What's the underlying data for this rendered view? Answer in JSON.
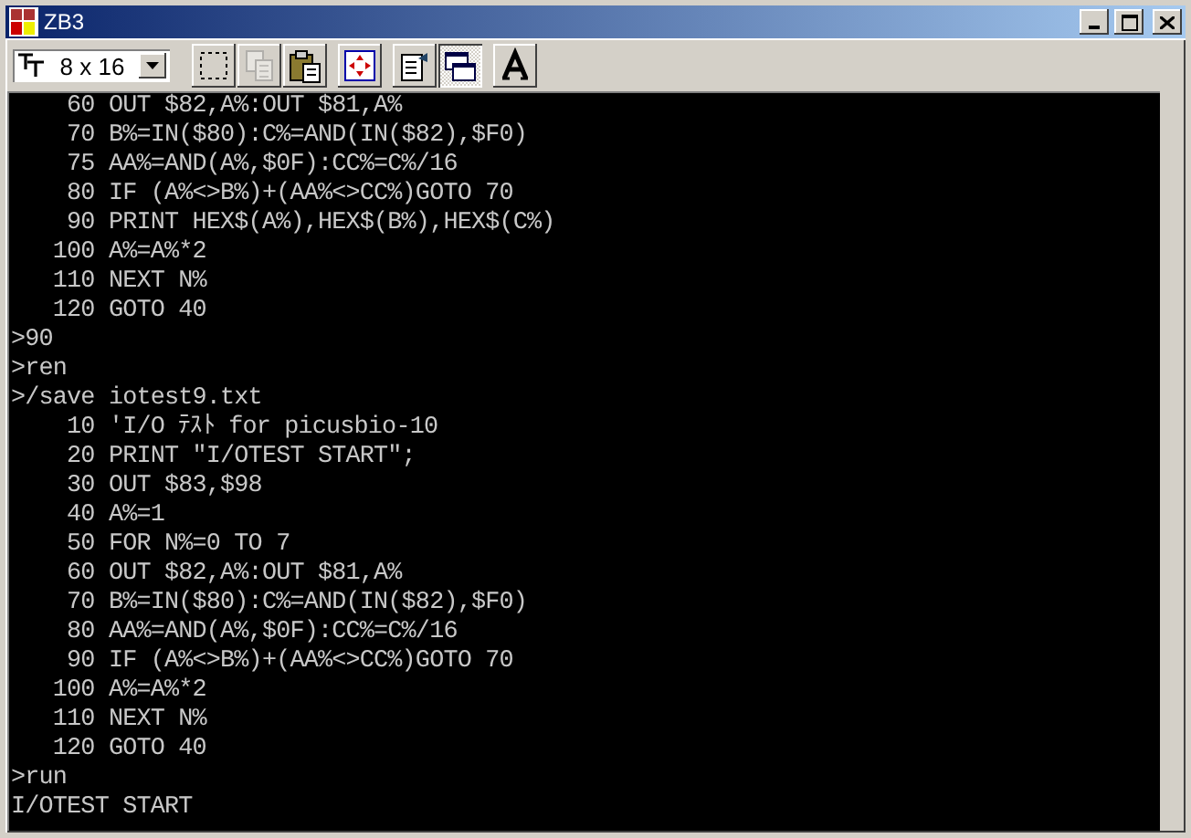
{
  "window": {
    "title": "ZB3"
  },
  "toolbar": {
    "font_selector": {
      "value": "8 x 16"
    },
    "buttons": [
      {
        "kind": "select",
        "disabled": false,
        "pressed": false
      },
      {
        "kind": "copy",
        "disabled": true,
        "pressed": false
      },
      {
        "kind": "paste",
        "disabled": false,
        "pressed": false
      },
      {
        "kind": "move",
        "disabled": false,
        "pressed": false
      },
      {
        "kind": "properties",
        "disabled": false,
        "pressed": false
      },
      {
        "kind": "window",
        "disabled": false,
        "pressed": true
      },
      {
        "kind": "font",
        "disabled": false,
        "pressed": false
      }
    ]
  },
  "terminal": {
    "lines": [
      "    60 OUT $82,A%:OUT $81,A%",
      "    70 B%=IN($80):C%=AND(IN($82),$F0)",
      "    75 AA%=AND(A%,$0F):CC%=C%/16",
      "    80 IF (A%<>B%)+(AA%<>CC%)GOTO 70",
      "    90 PRINT HEX$(A%),HEX$(B%),HEX$(C%)",
      "   100 A%=A%*2",
      "   110 NEXT N%",
      "   120 GOTO 40",
      ">90",
      ">ren",
      ">/save iotest9.txt",
      "    10 'I/O ﾃｽﾄ for picusbio-10",
      "    20 PRINT \"I/OTEST START\";",
      "    30 OUT $83,$98",
      "    40 A%=1",
      "    50 FOR N%=0 TO 7",
      "    60 OUT $82,A%:OUT $81,A%",
      "    70 B%=IN($80):C%=AND(IN($82),$F0)",
      "    80 AA%=AND(A%,$0F):CC%=C%/16",
      "    90 IF (A%<>B%)+(AA%<>CC%)GOTO 70",
      "   100 A%=A%*2",
      "   110 NEXT N%",
      "   120 GOTO 40",
      ">run",
      "I/OTEST START"
    ]
  }
}
